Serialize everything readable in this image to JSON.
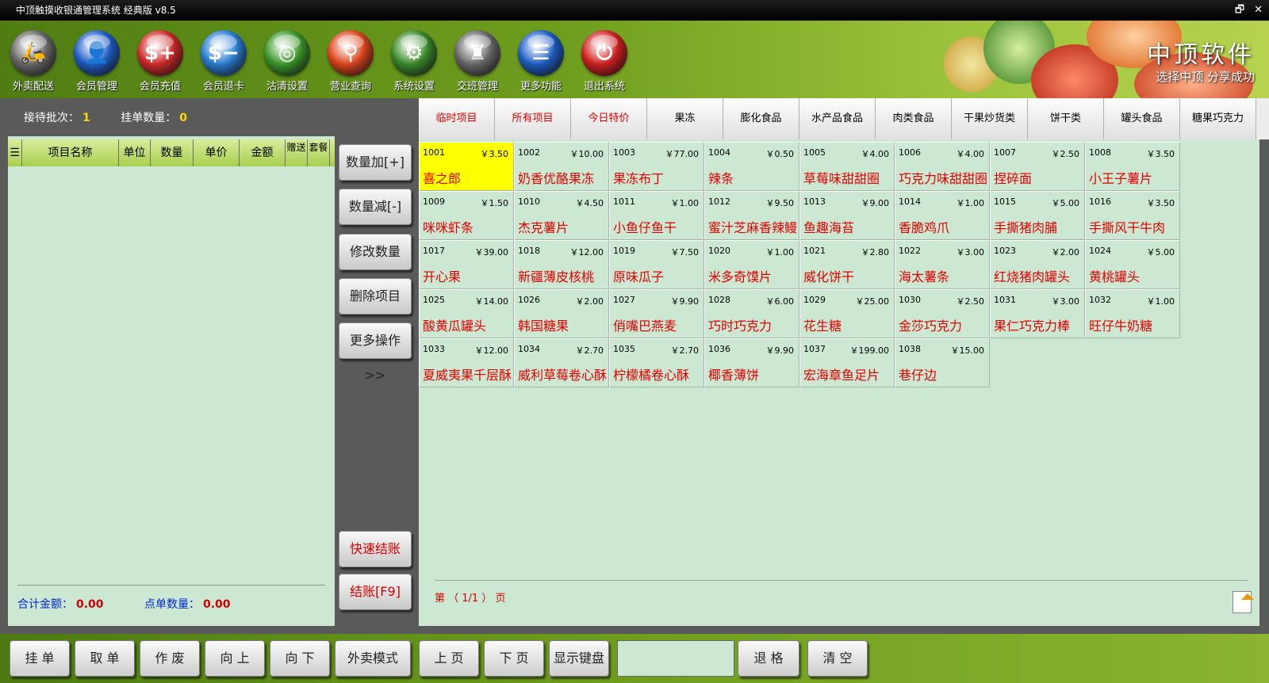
{
  "window": {
    "title": "中顶触摸收银通管理系统 经典版 v8.5",
    "restore_glyph": "🗗",
    "close_glyph": "✕"
  },
  "toolbar": [
    {
      "label": "外卖配送",
      "icon": "scooter-icon",
      "color": "#6b6b6b",
      "glyph": "🛵"
    },
    {
      "label": "会员管理",
      "icon": "user-icon",
      "color": "#1f5fc8",
      "glyph": "👤"
    },
    {
      "label": "会员充值",
      "icon": "card-add-icon",
      "color": "#d22a2a",
      "glyph": "$+"
    },
    {
      "label": "会员退卡",
      "icon": "card-remove-icon",
      "color": "#2a7fd6",
      "glyph": "$−"
    },
    {
      "label": "沽清设置",
      "icon": "plate-icon",
      "color": "#3d9a2c",
      "glyph": "◎"
    },
    {
      "label": "营业查询",
      "icon": "search-icon",
      "color": "#e0461d",
      "glyph": "⚲"
    },
    {
      "label": "系统设置",
      "icon": "gear-icon",
      "color": "#3b8d2a",
      "glyph": "⚙"
    },
    {
      "label": "交班管理",
      "icon": "handover-icon",
      "color": "#6b6b6b",
      "glyph": "♜"
    },
    {
      "label": "更多功能",
      "icon": "list-icon",
      "color": "#1f5fc8",
      "glyph": "☰"
    },
    {
      "label": "退出系统",
      "icon": "power-icon",
      "color": "#d32020",
      "glyph": "⏻"
    }
  ],
  "banner": {
    "brand": "中顶软件",
    "slogan": "选择中顶 分享成功"
  },
  "order": {
    "waiting_label": "接待批次：",
    "waiting_value": "1",
    "hold_label": "挂单数量：",
    "hold_value": "0",
    "columns": [
      "☰",
      "项目名称",
      "单位",
      "数量",
      "单价",
      "金额",
      "赠送",
      "套餐"
    ],
    "total_label": "合计金额：",
    "total_value": "0.00",
    "count_label": "点单数量：",
    "count_value": "0.00"
  },
  "mid_buttons": [
    "数量加[+]",
    "数量减[-]",
    "修改数量",
    "删除项目",
    "更多操作>>",
    "快速结账",
    "结账[F9]"
  ],
  "categories": [
    {
      "label": "临时项目",
      "red": true
    },
    {
      "label": "所有项目",
      "red": true
    },
    {
      "label": "今日特价",
      "red": true
    },
    {
      "label": "果冻",
      "red": false
    },
    {
      "label": "膨化食品",
      "red": false
    },
    {
      "label": "水产品食品",
      "red": false
    },
    {
      "label": "肉类食品",
      "red": false
    },
    {
      "label": "干果炒货类",
      "red": false
    },
    {
      "label": "饼干类",
      "red": false
    },
    {
      "label": "罐头食品",
      "red": false
    },
    {
      "label": "糖果巧克力",
      "red": false
    }
  ],
  "items": [
    {
      "code": "1001",
      "price": "￥3.50",
      "name": "喜之郎",
      "selected": true
    },
    {
      "code": "1002",
      "price": "￥10.00",
      "name": "奶香优酪果冻"
    },
    {
      "code": "1003",
      "price": "￥77.00",
      "name": "果冻布丁"
    },
    {
      "code": "1004",
      "price": "￥0.50",
      "name": "辣条"
    },
    {
      "code": "1005",
      "price": "￥4.00",
      "name": "草莓味甜甜圈"
    },
    {
      "code": "1006",
      "price": "￥4.00",
      "name": "巧克力味甜甜圈"
    },
    {
      "code": "1007",
      "price": "￥2.50",
      "name": "捏碎面"
    },
    {
      "code": "1008",
      "price": "￥3.50",
      "name": "小王子薯片"
    },
    {
      "code": "1009",
      "price": "￥1.50",
      "name": "咪咪虾条"
    },
    {
      "code": "1010",
      "price": "￥4.50",
      "name": "杰克薯片"
    },
    {
      "code": "1011",
      "price": "￥1.00",
      "name": "小鱼仔鱼干"
    },
    {
      "code": "1012",
      "price": "￥9.50",
      "name": "蜜汁芝麻香辣鳗"
    },
    {
      "code": "1013",
      "price": "￥9.00",
      "name": "鱼趣海苔"
    },
    {
      "code": "1014",
      "price": "￥1.00",
      "name": "香脆鸡爪"
    },
    {
      "code": "1015",
      "price": "￥5.00",
      "name": "手撕猪肉脯"
    },
    {
      "code": "1016",
      "price": "￥3.50",
      "name": "手撕风干牛肉"
    },
    {
      "code": "1017",
      "price": "￥39.00",
      "name": "开心果"
    },
    {
      "code": "1018",
      "price": "￥12.00",
      "name": "新疆薄皮核桃"
    },
    {
      "code": "1019",
      "price": "￥7.50",
      "name": "原味瓜子"
    },
    {
      "code": "1020",
      "price": "￥1.00",
      "name": "米多奇馍片"
    },
    {
      "code": "1021",
      "price": "￥2.80",
      "name": "威化饼干"
    },
    {
      "code": "1022",
      "price": "￥3.00",
      "name": "海太薯条"
    },
    {
      "code": "1023",
      "price": "￥2.00",
      "name": "红烧猪肉罐头"
    },
    {
      "code": "1024",
      "price": "￥5.00",
      "name": "黄桃罐头"
    },
    {
      "code": "1025",
      "price": "￥14.00",
      "name": "酸黄瓜罐头"
    },
    {
      "code": "1026",
      "price": "￥2.00",
      "name": "韩国糖果"
    },
    {
      "code": "1027",
      "price": "￥9.90",
      "name": "俏嘴巴燕麦"
    },
    {
      "code": "1028",
      "price": "￥6.00",
      "name": "巧时巧克力"
    },
    {
      "code": "1029",
      "price": "￥25.00",
      "name": "花生糖"
    },
    {
      "code": "1030",
      "price": "￥2.50",
      "name": "金莎巧克力"
    },
    {
      "code": "1031",
      "price": "￥3.00",
      "name": "果仁巧克力棒"
    },
    {
      "code": "1032",
      "price": "￥1.00",
      "name": "旺仔牛奶糖"
    },
    {
      "code": "1033",
      "price": "￥12.00",
      "name": "夏威夷果千层酥"
    },
    {
      "code": "1034",
      "price": "￥2.70",
      "name": "威利草莓卷心酥"
    },
    {
      "code": "1035",
      "price": "￥2.70",
      "name": "柠檬橘卷心酥"
    },
    {
      "code": "1036",
      "price": "￥9.90",
      "name": "椰香薄饼"
    },
    {
      "code": "1037",
      "price": "￥199.00",
      "name": "宏海章鱼足片"
    },
    {
      "code": "1038",
      "price": "￥15.00",
      "name": "巷仔边"
    }
  ],
  "pagination": {
    "text": "第 （ 1/1 ） 页"
  },
  "bottom_buttons": [
    "挂 单",
    "取 单",
    "作 废",
    "向 上",
    "向 下",
    "外卖模式",
    "上 页",
    "下 页",
    "显示键盘",
    "退 格",
    "清 空"
  ],
  "bottom_input": {
    "value": ""
  }
}
